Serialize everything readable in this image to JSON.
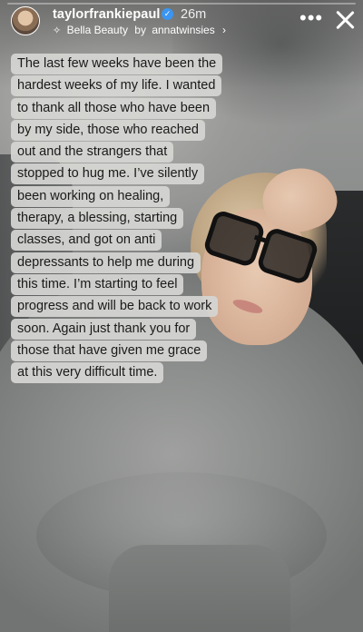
{
  "story": {
    "progress": 0.0,
    "user": {
      "username": "taylorfrankiepaul",
      "verified": true,
      "time_ago": "26m"
    },
    "music": {
      "title": "Bella Beauty",
      "by": "by",
      "artist": "annatwinsies"
    },
    "icons": {
      "verified": "verified-badge-icon",
      "music": "music-sparkle-icon",
      "chevron": "chevron-right-icon",
      "more": "more-options-icon",
      "close": "close-icon"
    },
    "caption_lines": [
      "The last few weeks have been the",
      "hardest weeks of my life. I wanted",
      "to thank all those who have been",
      "by my side, those who reached",
      "out and the strangers that",
      "stopped to hug me. I’ve silently",
      "been working on healing,",
      "therapy, a blessing, starting",
      "classes, and got on anti",
      "depressants to help me during",
      "this time. I’m starting to feel",
      "progress and will be back to work",
      "soon. Again just thank you for",
      "those that have given me grace",
      "at this very difficult time."
    ]
  },
  "colors": {
    "verified_blue": "#3b95f2",
    "caption_bg": "#d5d5d3",
    "text_light": "#ffffff"
  }
}
